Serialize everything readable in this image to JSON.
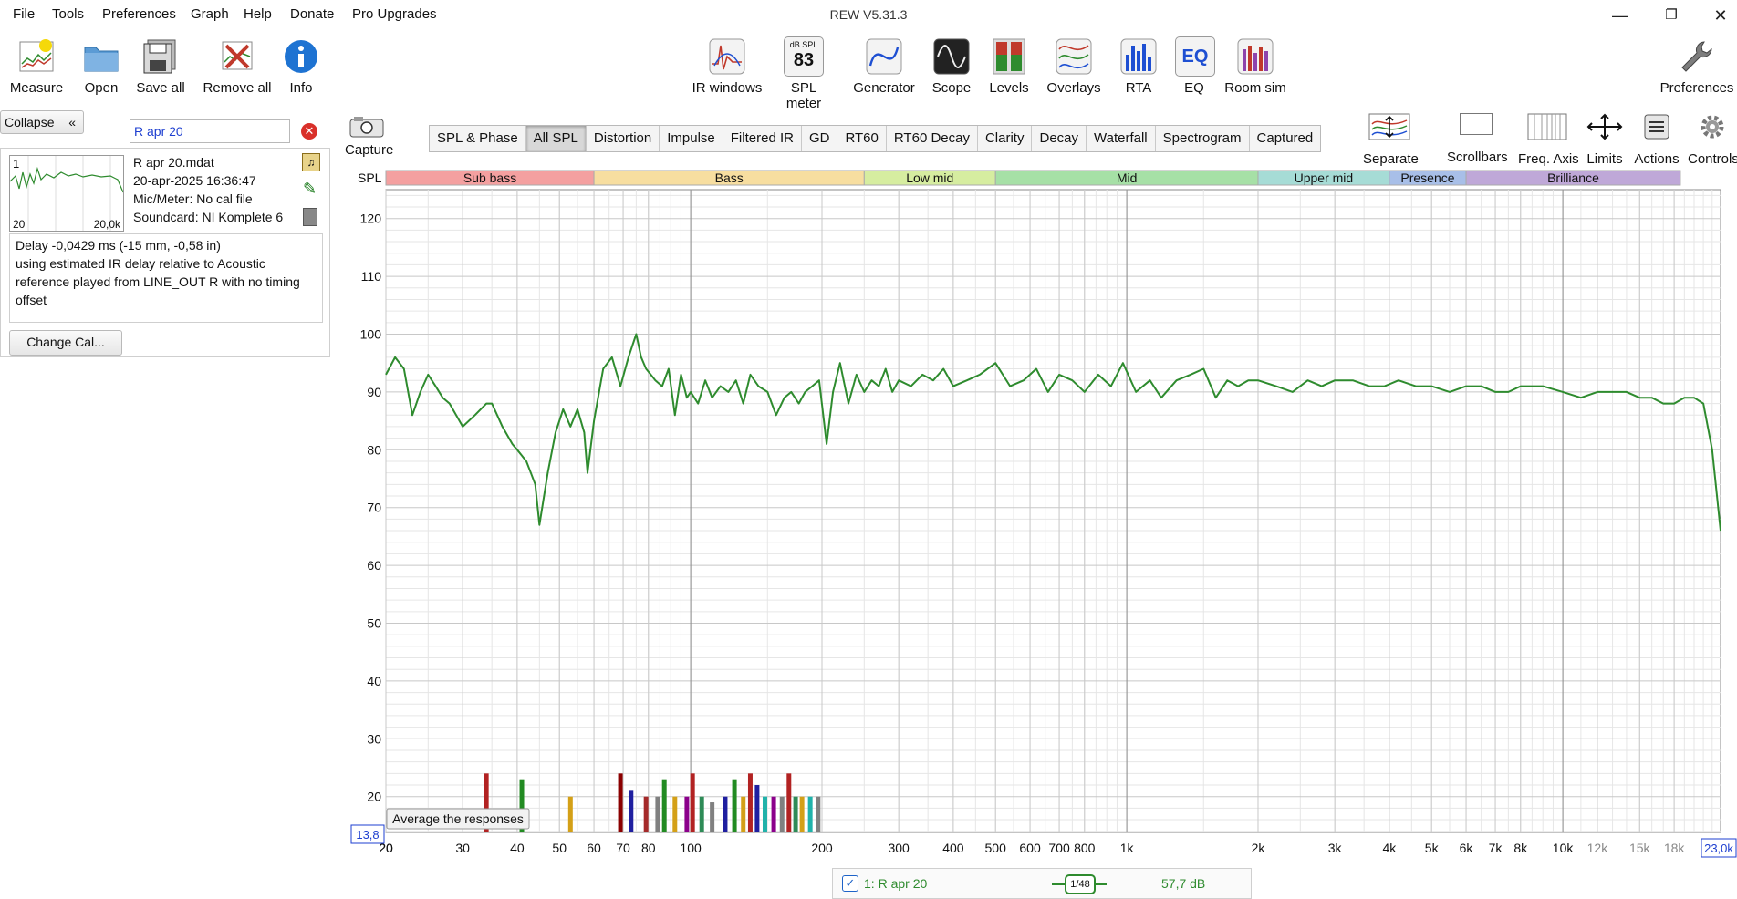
{
  "menu": [
    "File",
    "Tools",
    "Preferences",
    "Graph",
    "Help",
    "Donate",
    "Pro Upgrades"
  ],
  "app_title": "REW V5.31.3",
  "toolbar_left": [
    {
      "label": "Measure",
      "icon": "measure-icon"
    },
    {
      "label": "Open",
      "icon": "folder-icon"
    },
    {
      "label": "Save all",
      "icon": "floppy-disk-icon"
    },
    {
      "label": "Remove all",
      "icon": "remove-all-icon"
    },
    {
      "label": "Info",
      "icon": "info-icon"
    }
  ],
  "toolbar_center": [
    {
      "label": "IR windows",
      "icon": "ir-windows-icon"
    },
    {
      "label": "SPL meter",
      "icon": "spl-meter-icon",
      "badge_top": "dB SPL",
      "badge_value": "83"
    },
    {
      "label": "Generator",
      "icon": "generator-icon"
    },
    {
      "label": "Scope",
      "icon": "scope-icon"
    },
    {
      "label": "Levels",
      "icon": "levels-icon"
    },
    {
      "label": "Overlays",
      "icon": "overlays-icon"
    },
    {
      "label": "RTA",
      "icon": "rta-icon"
    },
    {
      "label": "EQ",
      "icon": "eq-icon"
    },
    {
      "label": "Room sim",
      "icon": "room-sim-icon"
    }
  ],
  "toolbar_right": {
    "label": "Preferences",
    "icon": "wrench-icon"
  },
  "left_panel": {
    "collapse_label": "Collapse",
    "search_value": "R apr 20",
    "measurement": {
      "index": "1",
      "name": "R apr 20.mdat",
      "date": "20-apr-2025 16:36:47",
      "mic": "Mic/Meter: No cal file",
      "soundcard": "Soundcard: NI Komplete 6",
      "thumb_min": "20",
      "thumb_max": "20,0k"
    },
    "delay_lines": [
      "Delay -0,0429 ms (-15 mm, -0,58 in)",
      "using estimated IR delay relative to Acoustic",
      "reference played from LINE_OUT R with no timing",
      "offset"
    ],
    "change_cal_label": "Change Cal..."
  },
  "capture_label": "Capture",
  "tabs": [
    "SPL & Phase",
    "All SPL",
    "Distortion",
    "Impulse",
    "Filtered IR",
    "GD",
    "RT60",
    "RT60 Decay",
    "Clarity",
    "Decay",
    "Waterfall",
    "Spectrogram",
    "Captured"
  ],
  "active_tab": "All SPL",
  "graph_tools": [
    {
      "label": "Separate",
      "icon": "separate-icon"
    },
    {
      "label": "Scrollbars",
      "icon": "scrollbars-icon"
    },
    {
      "label": "Freq. Axis",
      "icon": "freq-axis-icon"
    },
    {
      "label": "Limits",
      "icon": "limits-icon"
    },
    {
      "label": "Actions",
      "icon": "actions-icon"
    },
    {
      "label": "Controls",
      "icon": "gear-icon"
    }
  ],
  "bands": [
    {
      "name": "Sub bass",
      "from": 20,
      "to": 60,
      "color": "#f4a0a0"
    },
    {
      "name": "Bass",
      "from": 60,
      "to": 250,
      "color": "#f7dea0"
    },
    {
      "name": "Low mid",
      "from": 250,
      "to": 500,
      "color": "#d6eda0"
    },
    {
      "name": "Mid",
      "from": 500,
      "to": 2000,
      "color": "#a6e0a6"
    },
    {
      "name": "Upper mid",
      "from": 2000,
      "to": 4000,
      "color": "#a6dcd6"
    },
    {
      "name": "Presence",
      "from": 4000,
      "to": 6000,
      "color": "#a8bfe8"
    },
    {
      "name": "Brilliance",
      "from": 6000,
      "to": 20000,
      "color": "#bfa8d8"
    }
  ],
  "chart_data": {
    "type": "line",
    "ylabel": "SPL",
    "ylim": [
      13.8,
      125
    ],
    "xlim": [
      20,
      23000
    ],
    "x_scale": "log",
    "yticks": [
      20,
      30,
      40,
      50,
      60,
      70,
      80,
      90,
      100,
      110,
      120
    ],
    "xticks": [
      {
        "v": 20,
        "l": "20"
      },
      {
        "v": 30,
        "l": "30"
      },
      {
        "v": 40,
        "l": "40"
      },
      {
        "v": 50,
        "l": "50"
      },
      {
        "v": 60,
        "l": "60"
      },
      {
        "v": 70,
        "l": "70"
      },
      {
        "v": 80,
        "l": "80"
      },
      {
        "v": 100,
        "l": "100"
      },
      {
        "v": 200,
        "l": "200"
      },
      {
        "v": 300,
        "l": "300"
      },
      {
        "v": 400,
        "l": "400"
      },
      {
        "v": 500,
        "l": "500"
      },
      {
        "v": 600,
        "l": "600"
      },
      {
        "v": 700,
        "l": "700"
      },
      {
        "v": 800,
        "l": "800"
      },
      {
        "v": 1000,
        "l": "1k"
      },
      {
        "v": 2000,
        "l": "2k"
      },
      {
        "v": 3000,
        "l": "3k"
      },
      {
        "v": 4000,
        "l": "4k"
      },
      {
        "v": 5000,
        "l": "5k"
      },
      {
        "v": 6000,
        "l": "6k"
      },
      {
        "v": 7000,
        "l": "7k"
      },
      {
        "v": 8000,
        "l": "8k"
      },
      {
        "v": 10000,
        "l": "10k"
      },
      {
        "v": 12000,
        "l": "12k"
      },
      {
        "v": 15000,
        "l": "15k"
      },
      {
        "v": 18000,
        "l": "18k"
      }
    ],
    "x_min_label": "20",
    "x_max_label": "23,0k",
    "y_min_label": "13,8",
    "grid": true,
    "series": [
      {
        "name": "1: R apr 20",
        "color": "#2e8b2e",
        "x": [
          20,
          21,
          22,
          23,
          24,
          25,
          26,
          27,
          28,
          30,
          32,
          34,
          35,
          37,
          39,
          40,
          41,
          42,
          43,
          44,
          45,
          47,
          49,
          51,
          53,
          55,
          57,
          58,
          60,
          63,
          66,
          69,
          72,
          75,
          77,
          79,
          81,
          83,
          86,
          89,
          92,
          95,
          98,
          100,
          104,
          108,
          112,
          117,
          122,
          127,
          132,
          137,
          143,
          150,
          157,
          164,
          170,
          177,
          183,
          190,
          197,
          205,
          212,
          220,
          230,
          240,
          250,
          260,
          270,
          280,
          290,
          300,
          320,
          340,
          360,
          380,
          400,
          430,
          460,
          500,
          540,
          580,
          620,
          660,
          700,
          750,
          800,
          860,
          920,
          980,
          1050,
          1130,
          1200,
          1300,
          1400,
          1500,
          1600,
          1700,
          1800,
          1900,
          2000,
          2200,
          2400,
          2600,
          2800,
          3000,
          3300,
          3600,
          3900,
          4200,
          4600,
          5000,
          5500,
          6000,
          6500,
          7000,
          7500,
          8000,
          9000,
          10000,
          11000,
          12000,
          13000,
          14000,
          15000,
          16000,
          17000,
          18000,
          19000,
          20000,
          21000,
          22000,
          23000
        ],
        "y": [
          93,
          96,
          94,
          86,
          90,
          93,
          91,
          89,
          88,
          84,
          86,
          88,
          88,
          84,
          81,
          80,
          79,
          78,
          76,
          74,
          67,
          76,
          83,
          87,
          84,
          87,
          83,
          76,
          85,
          94,
          96,
          91,
          96,
          100,
          96,
          94,
          93,
          92,
          91,
          94,
          86,
          93,
          89,
          90,
          88,
          92,
          89,
          91,
          90,
          92,
          88,
          93,
          91,
          90,
          86,
          89,
          90,
          88,
          90,
          91,
          92,
          81,
          90,
          95,
          88,
          93,
          90,
          92,
          91,
          94,
          90,
          92,
          91,
          93,
          92,
          94,
          91,
          92,
          93,
          95,
          91,
          92,
          94,
          90,
          93,
          92,
          90,
          93,
          91,
          95,
          90,
          92,
          89,
          92,
          93,
          94,
          89,
          92,
          91,
          92,
          92,
          91,
          90,
          92,
          91,
          92,
          92,
          91,
          91,
          92,
          91,
          91,
          90,
          91,
          91,
          90,
          90,
          91,
          91,
          90,
          89,
          90,
          90,
          90,
          89,
          89,
          88,
          88,
          89,
          89,
          88,
          80,
          66
        ]
      }
    ],
    "avg_bars": [
      {
        "f": 34,
        "v": 24,
        "c": "#b22222"
      },
      {
        "f": 41,
        "v": 23,
        "c": "#228b22"
      },
      {
        "f": 53,
        "v": 20,
        "c": "#d4a017"
      },
      {
        "f": 69,
        "v": 24,
        "c": "#8b0000"
      },
      {
        "f": 73,
        "v": 21,
        "c": "#1f1fa0"
      },
      {
        "f": 79,
        "v": 20,
        "c": "#a52a2a"
      },
      {
        "f": 84,
        "v": 20,
        "c": "#808080"
      },
      {
        "f": 87,
        "v": 23,
        "c": "#228b22"
      },
      {
        "f": 92,
        "v": 20,
        "c": "#d4a017"
      },
      {
        "f": 98,
        "v": 20,
        "c": "#8b008b"
      },
      {
        "f": 101,
        "v": 24,
        "c": "#b22222"
      },
      {
        "f": 106,
        "v": 20,
        "c": "#2e8b57"
      },
      {
        "f": 112,
        "v": 19,
        "c": "#808080"
      },
      {
        "f": 120,
        "v": 20,
        "c": "#1f1fa0"
      },
      {
        "f": 126,
        "v": 23,
        "c": "#228b22"
      },
      {
        "f": 132,
        "v": 20,
        "c": "#d4a017"
      },
      {
        "f": 137,
        "v": 24,
        "c": "#b22222"
      },
      {
        "f": 142,
        "v": 22,
        "c": "#1f1fa0"
      },
      {
        "f": 148,
        "v": 20,
        "c": "#20b2aa"
      },
      {
        "f": 155,
        "v": 20,
        "c": "#8b008b"
      },
      {
        "f": 162,
        "v": 20,
        "c": "#808080"
      },
      {
        "f": 168,
        "v": 24,
        "c": "#b22222"
      },
      {
        "f": 174,
        "v": 20,
        "c": "#2e8b57"
      },
      {
        "f": 180,
        "v": 20,
        "c": "#d4a017"
      },
      {
        "f": 188,
        "v": 20,
        "c": "#20b2aa"
      },
      {
        "f": 196,
        "v": 20,
        "c": "#808080"
      }
    ],
    "avg_label": "Average the responses"
  },
  "legend": {
    "checked": true,
    "name": "1: R apr 20",
    "smoothing": "1/48",
    "offset": "57,7 dB",
    "color": "#2e8b2e"
  }
}
